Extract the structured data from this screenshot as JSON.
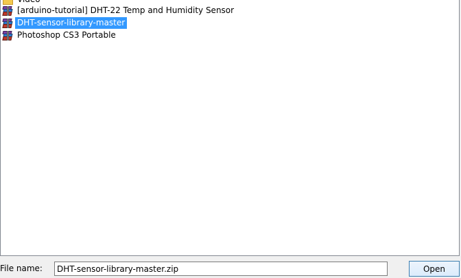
{
  "file_list": {
    "items": [
      {
        "label": "Video",
        "icon": "folder-icon",
        "selected": false
      },
      {
        "label": "[arduino-tutorial] DHT-22 Temp and Humidity Sensor",
        "icon": "archive-icon",
        "selected": false
      },
      {
        "label": "DHT-sensor-library-master",
        "icon": "archive-icon",
        "selected": true
      },
      {
        "label": "Photoshop CS3 Portable",
        "icon": "archive-icon",
        "selected": false
      }
    ]
  },
  "footer": {
    "file_name_label": "File name:",
    "file_name_value": "DHT-sensor-library-master.zip",
    "open_label": "Open"
  },
  "colors": {
    "selection": "#3399ff",
    "list_background": "#ffffff",
    "dialog_background": "#f0f0f0"
  }
}
